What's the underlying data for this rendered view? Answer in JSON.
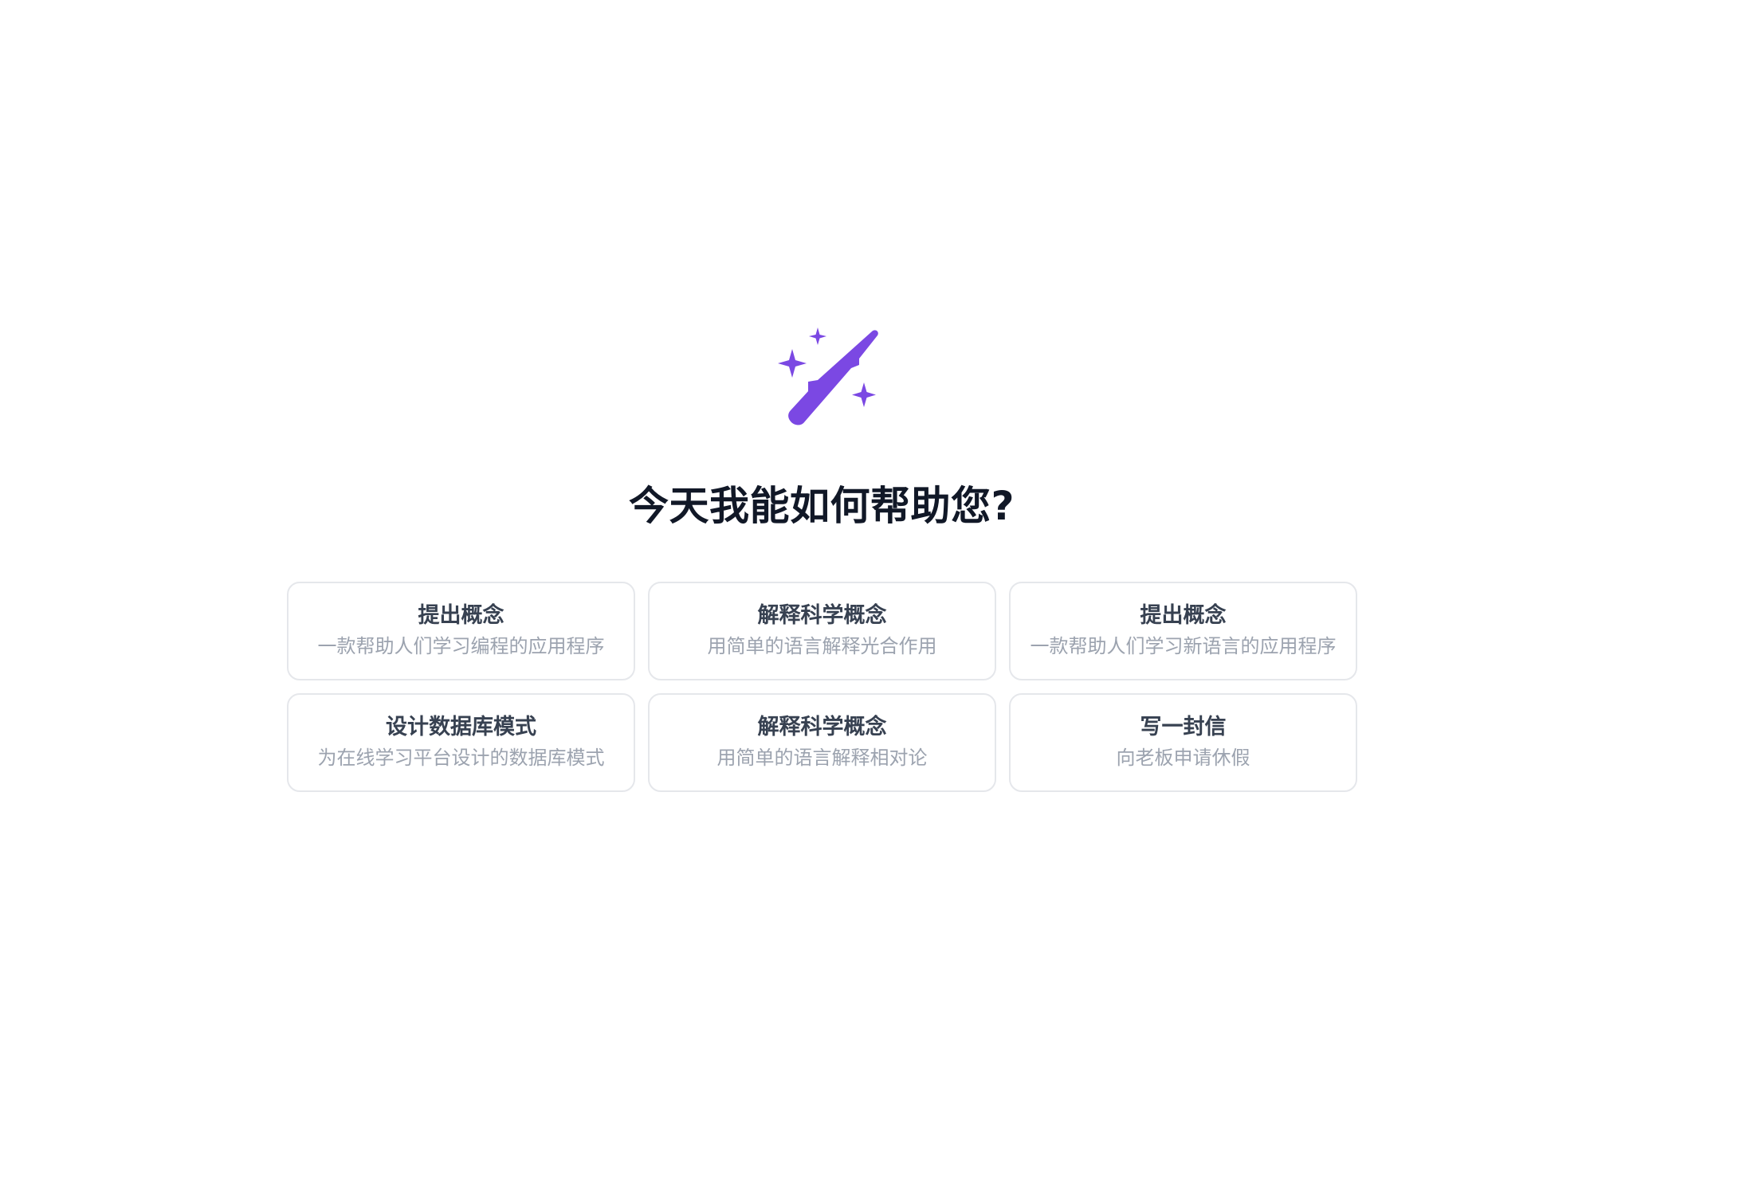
{
  "hero": {
    "icon": "magic-wand-sparkles-icon",
    "icon_color": "#7b48e3",
    "title": "今天我能如何帮助您?"
  },
  "suggestions": [
    {
      "title": "提出概念",
      "subtitle": "一款帮助人们学习编程的应用程序"
    },
    {
      "title": "解释科学概念",
      "subtitle": "用简单的语言解释光合作用"
    },
    {
      "title": "提出概念",
      "subtitle": "一款帮助人们学习新语言的应用程序"
    },
    {
      "title": "设计数据库模式",
      "subtitle": "为在线学习平台设计的数据库模式"
    },
    {
      "title": "解释科学概念",
      "subtitle": "用简单的语言解释相对论"
    },
    {
      "title": "写一封信",
      "subtitle": "向老板申请休假"
    }
  ],
  "colors": {
    "title": "#111827",
    "card_title": "#374151",
    "card_subtitle": "#9ca3af",
    "card_border": "#e5e7eb"
  }
}
